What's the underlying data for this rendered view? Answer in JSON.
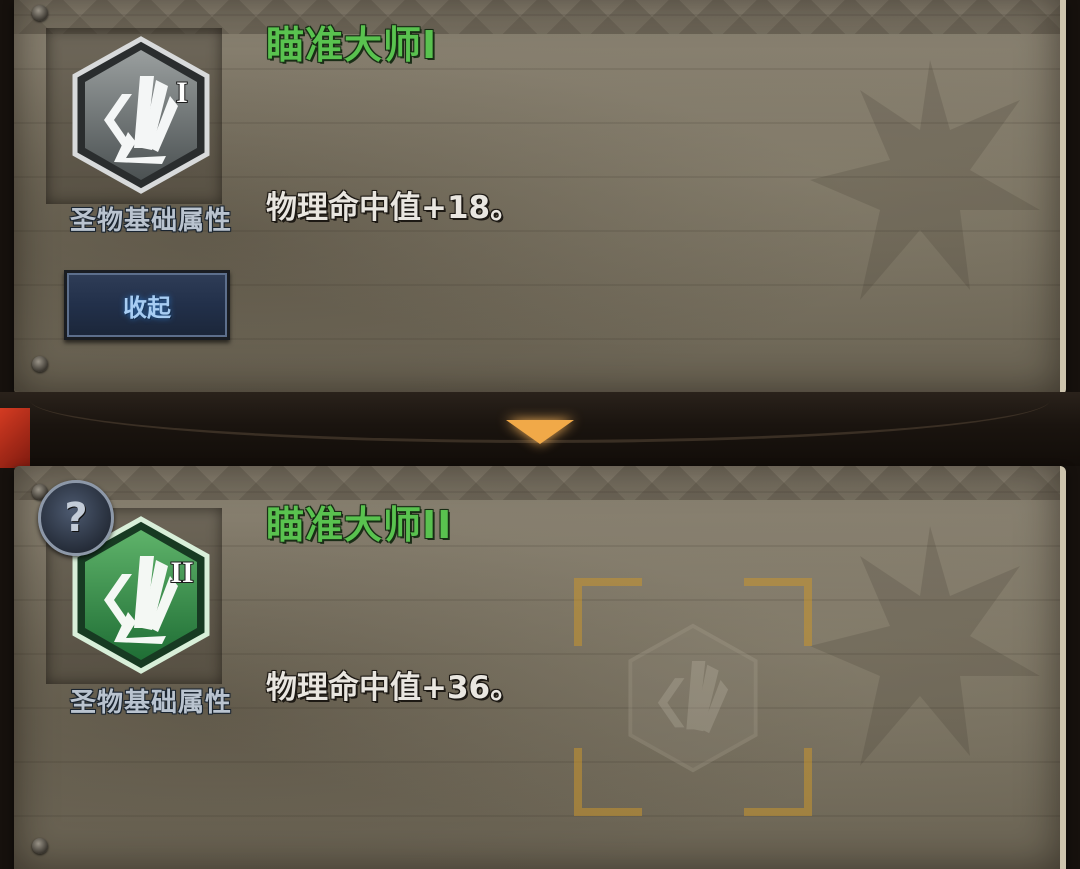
{
  "skills": [
    {
      "title": "瞄准大师I",
      "tier_numeral": "I",
      "category": "圣物基础属性",
      "description": "物理命中值+18。",
      "icon": "shard-burst-icon",
      "icon_color": "#6d7374"
    },
    {
      "title": "瞄准大师II",
      "tier_numeral": "II",
      "category": "圣物基础属性",
      "description": "物理命中值+36。",
      "icon": "shard-burst-icon",
      "icon_color": "#2f8a45"
    }
  ],
  "collapse_button": {
    "label": "收起"
  },
  "help_button": {
    "icon": "question-icon",
    "glyph": "?"
  },
  "expand_arrow": {
    "icon": "chevron-down-icon"
  },
  "colors": {
    "title_green": "#59c24f",
    "desc_white": "#e9e6e0",
    "button_text": "#a8cdf3",
    "arrow_orange": "#f1a948",
    "target_gold": "#c9962e"
  }
}
